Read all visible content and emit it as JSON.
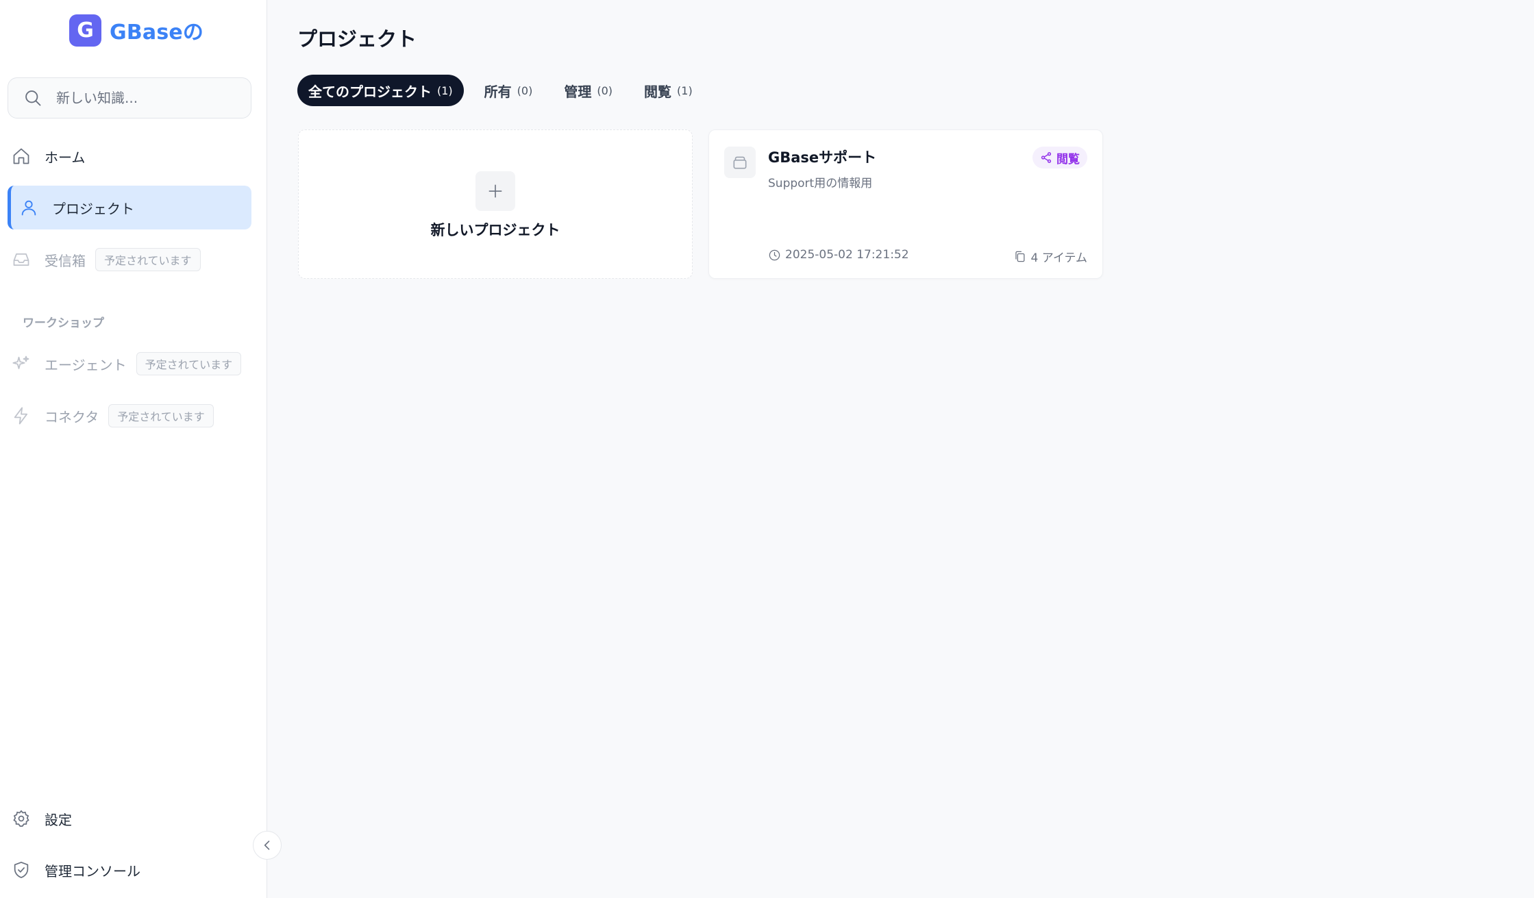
{
  "app": {
    "logo_letter": "G",
    "name": "GBaseの",
    "brand_color": "#6366f1",
    "accent_color": "#3b82f6"
  },
  "search": {
    "placeholder": "新しい知識..."
  },
  "sidebar": {
    "items": [
      {
        "label": "ホーム",
        "icon": "home-icon"
      },
      {
        "label": "プロジェクト",
        "icon": "user-icon",
        "active": true
      },
      {
        "label": "受信箱",
        "icon": "inbox-icon",
        "badge": "予定されています",
        "disabled": true
      }
    ],
    "section_label": "ワークショップ",
    "workshop_items": [
      {
        "label": "エージェント",
        "icon": "sparkles-icon",
        "badge": "予定されています",
        "disabled": true
      },
      {
        "label": "コネクタ",
        "icon": "lightning-icon",
        "badge": "予定されています",
        "disabled": true
      }
    ],
    "bottom_items": [
      {
        "label": "設定",
        "icon": "gear-icon"
      },
      {
        "label": "管理コンソール",
        "icon": "shield-icon"
      }
    ]
  },
  "main": {
    "title": "プロジェクト",
    "tabs": [
      {
        "label": "全てのプロジェクト",
        "count": "(1)",
        "active": true
      },
      {
        "label": "所有",
        "count": "(0)"
      },
      {
        "label": "管理",
        "count": "(0)"
      },
      {
        "label": "閲覧",
        "count": "(1)"
      }
    ],
    "new_project_label": "新しいプロジェクト",
    "projects": [
      {
        "name": "GBaseサポート",
        "description": "Support用の情報用",
        "badge": "閲覧",
        "badge_color": "#9333ea",
        "date": "2025-05-02 17:21:52",
        "items": "4 アイテム"
      }
    ]
  }
}
